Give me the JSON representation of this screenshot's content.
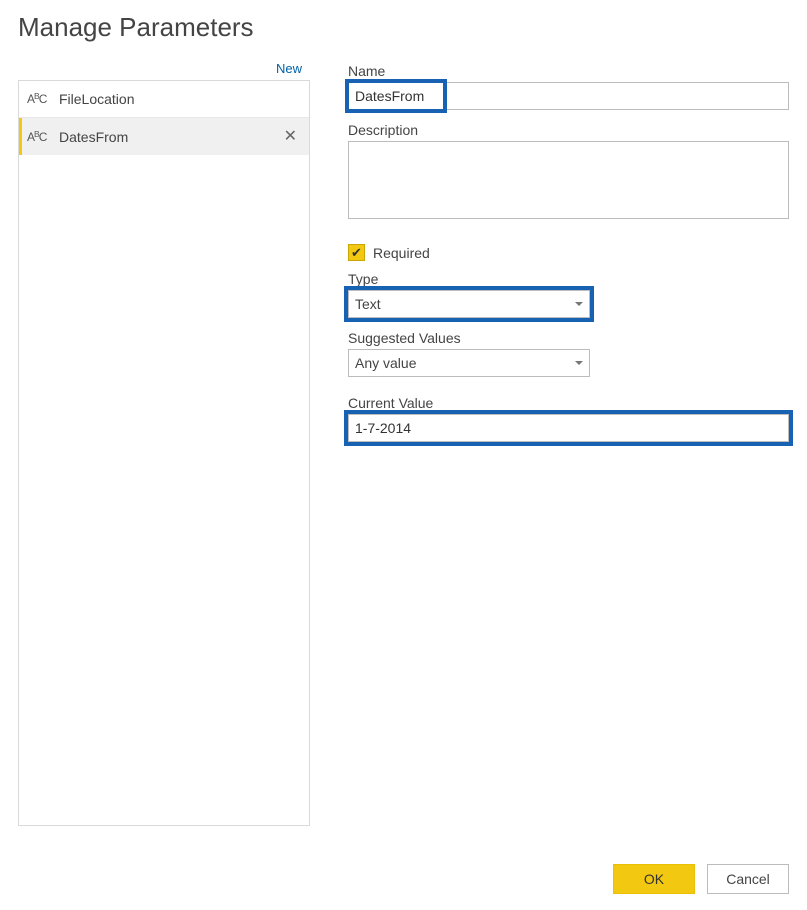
{
  "title": "Manage Parameters",
  "newLink": "New",
  "parameters": {
    "items": [
      {
        "name": "FileLocation",
        "selected": false
      },
      {
        "name": "DatesFrom",
        "selected": true
      }
    ]
  },
  "form": {
    "nameLabel": "Name",
    "nameValue": "DatesFrom",
    "descriptionLabel": "Description",
    "descriptionValue": "",
    "requiredLabel": "Required",
    "requiredChecked": true,
    "typeLabel": "Type",
    "typeValue": "Text",
    "suggestedLabel": "Suggested Values",
    "suggestedValue": "Any value",
    "currentLabel": "Current Value",
    "currentValue": "1-7-2014"
  },
  "buttons": {
    "ok": "OK",
    "cancel": "Cancel"
  },
  "highlightColor": "#1862b3",
  "accentColor": "#f2c811"
}
